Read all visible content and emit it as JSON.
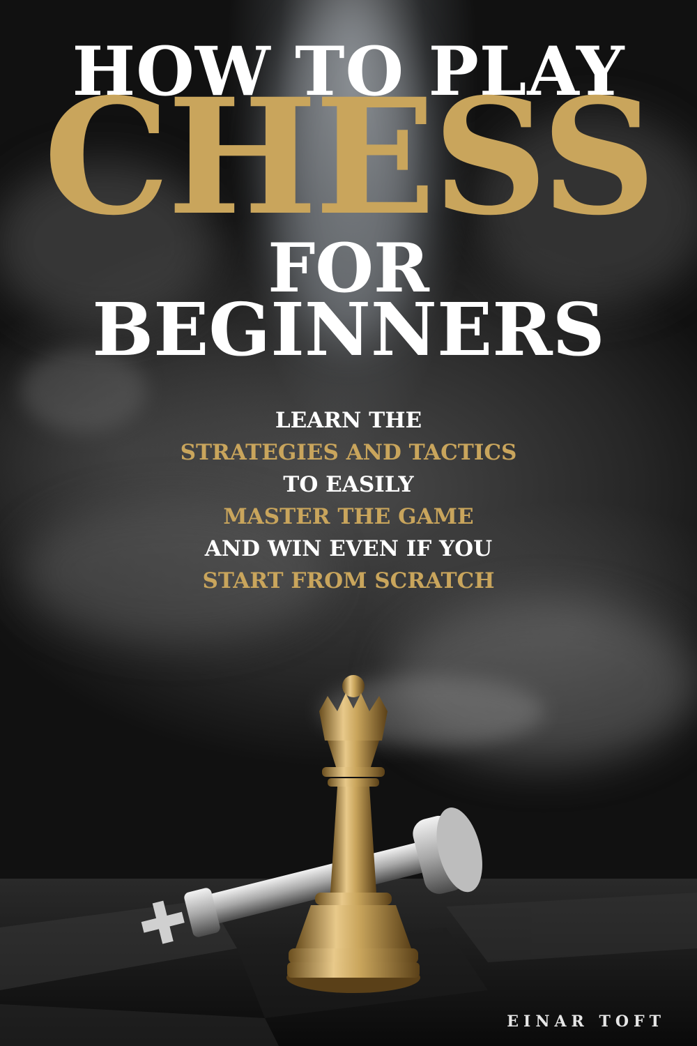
{
  "cover": {
    "title_line1": "HOW TO PLAY",
    "title_line2": "CHESS",
    "title_line3": "FOR",
    "title_line4": "BEGINNERS",
    "subtitle": [
      {
        "text": "LEARN THE",
        "color": "white"
      },
      {
        "text": "STRATEGIES AND TACTICS",
        "color": "gold"
      },
      {
        "text": "TO EASILY",
        "color": "white"
      },
      {
        "text": "MASTER THE GAME",
        "color": "gold"
      },
      {
        "text": "AND WIN EVEN IF YOU",
        "color": "white"
      },
      {
        "text": "START FROM SCRATCH",
        "color": "gold"
      }
    ],
    "author": "EINAR TOFT"
  },
  "colors": {
    "gold": "#c9a55c",
    "white": "#ffffff",
    "background": "#1a1a1a"
  },
  "icons": {
    "standing_piece": "gold-queen-icon",
    "fallen_piece": "silver-king-icon"
  }
}
